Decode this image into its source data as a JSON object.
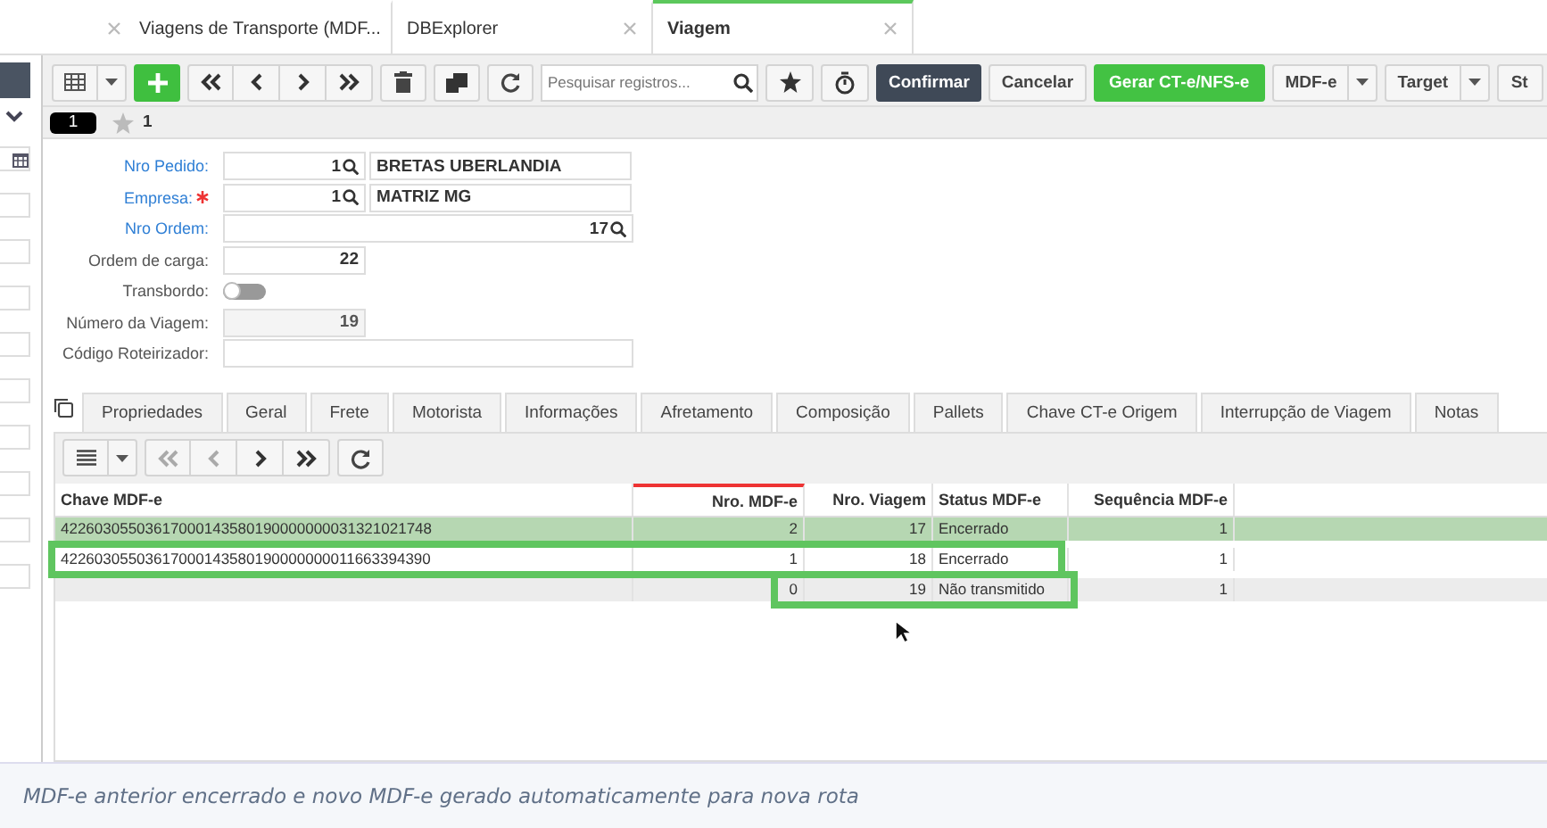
{
  "tabs": [
    {
      "label": "Viagens de Transporte (MDF...",
      "selected": false
    },
    {
      "label": "DBExplorer",
      "selected": false
    },
    {
      "label": "Viagem",
      "selected": true
    }
  ],
  "toolbar": {
    "search": {
      "placeholder": "Pesquisar registros..."
    },
    "buttons": [
      {
        "label": "Confirmar",
        "kind": "dark"
      },
      {
        "label": "Cancelar",
        "kind": "plain"
      },
      {
        "label": "Gerar CT-e/NFS-e",
        "kind": "green"
      },
      {
        "label": "MDF-e",
        "kind": "menu"
      },
      {
        "label": "Target",
        "kind": "menu"
      },
      {
        "label": "St",
        "kind": "plain"
      }
    ]
  },
  "record_bar": {
    "index": "1",
    "favorites": "1"
  },
  "form": [
    {
      "label": "Nro Pedido:",
      "kind": "lookup",
      "link": true,
      "required": false,
      "value": "1",
      "name": "BRETAS UBERLANDIA"
    },
    {
      "label": "Empresa:",
      "kind": "lookup",
      "link": true,
      "required": true,
      "value": "1",
      "name": "MATRIZ MG"
    },
    {
      "label": "Nro Ordem:",
      "kind": "wide-lookup",
      "link": true,
      "required": false,
      "value": "17"
    },
    {
      "label": "Ordem de carga:",
      "kind": "number",
      "link": false,
      "required": false,
      "value": "22"
    },
    {
      "label": "Transbordo:",
      "kind": "toggle",
      "link": false,
      "required": false,
      "on": false
    },
    {
      "label": "Número da Viagem:",
      "kind": "readonly",
      "link": false,
      "required": false,
      "value": "19"
    },
    {
      "label": "Código Roteirizador:",
      "kind": "text",
      "link": false,
      "required": false
    }
  ],
  "detail_tabs": [
    {
      "label": "Propriedades",
      "selected": false
    },
    {
      "label": "Geral",
      "selected": false
    },
    {
      "label": "Frete",
      "selected": false
    },
    {
      "label": "Motorista",
      "selected": false
    },
    {
      "label": "Informações",
      "selected": false
    },
    {
      "label": "Afretamento",
      "selected": false
    },
    {
      "label": "Composição",
      "selected": false
    },
    {
      "label": "Pallets",
      "selected": false
    },
    {
      "label": "Chave CT-e Origem",
      "selected": false
    },
    {
      "label": "Interrupção de Viagem",
      "selected": false
    },
    {
      "label": "Notas",
      "selected": false
    }
  ],
  "grid": {
    "columns": [
      "Chave MDF-e",
      "Nro. MDF-e",
      "Nro. Viagem",
      "Status MDF-e",
      "Sequência MDF-e"
    ],
    "rows": [
      {
        "cells": [
          "42260305503617000143580190000000031321021748",
          "2",
          "17",
          "Encerrado",
          "1"
        ],
        "selected": true
      },
      {
        "cells": [
          "42260305503617000143580190000000011663394390",
          "1",
          "18",
          "Encerrado",
          "1"
        ],
        "selected": false
      },
      {
        "cells": [
          "",
          "0",
          "19",
          "Não transmitido",
          "1"
        ],
        "selected": false
      }
    ]
  },
  "caption": "MDF-e anterior encerrado e novo MDF-e gerado automaticamente para nova rota"
}
